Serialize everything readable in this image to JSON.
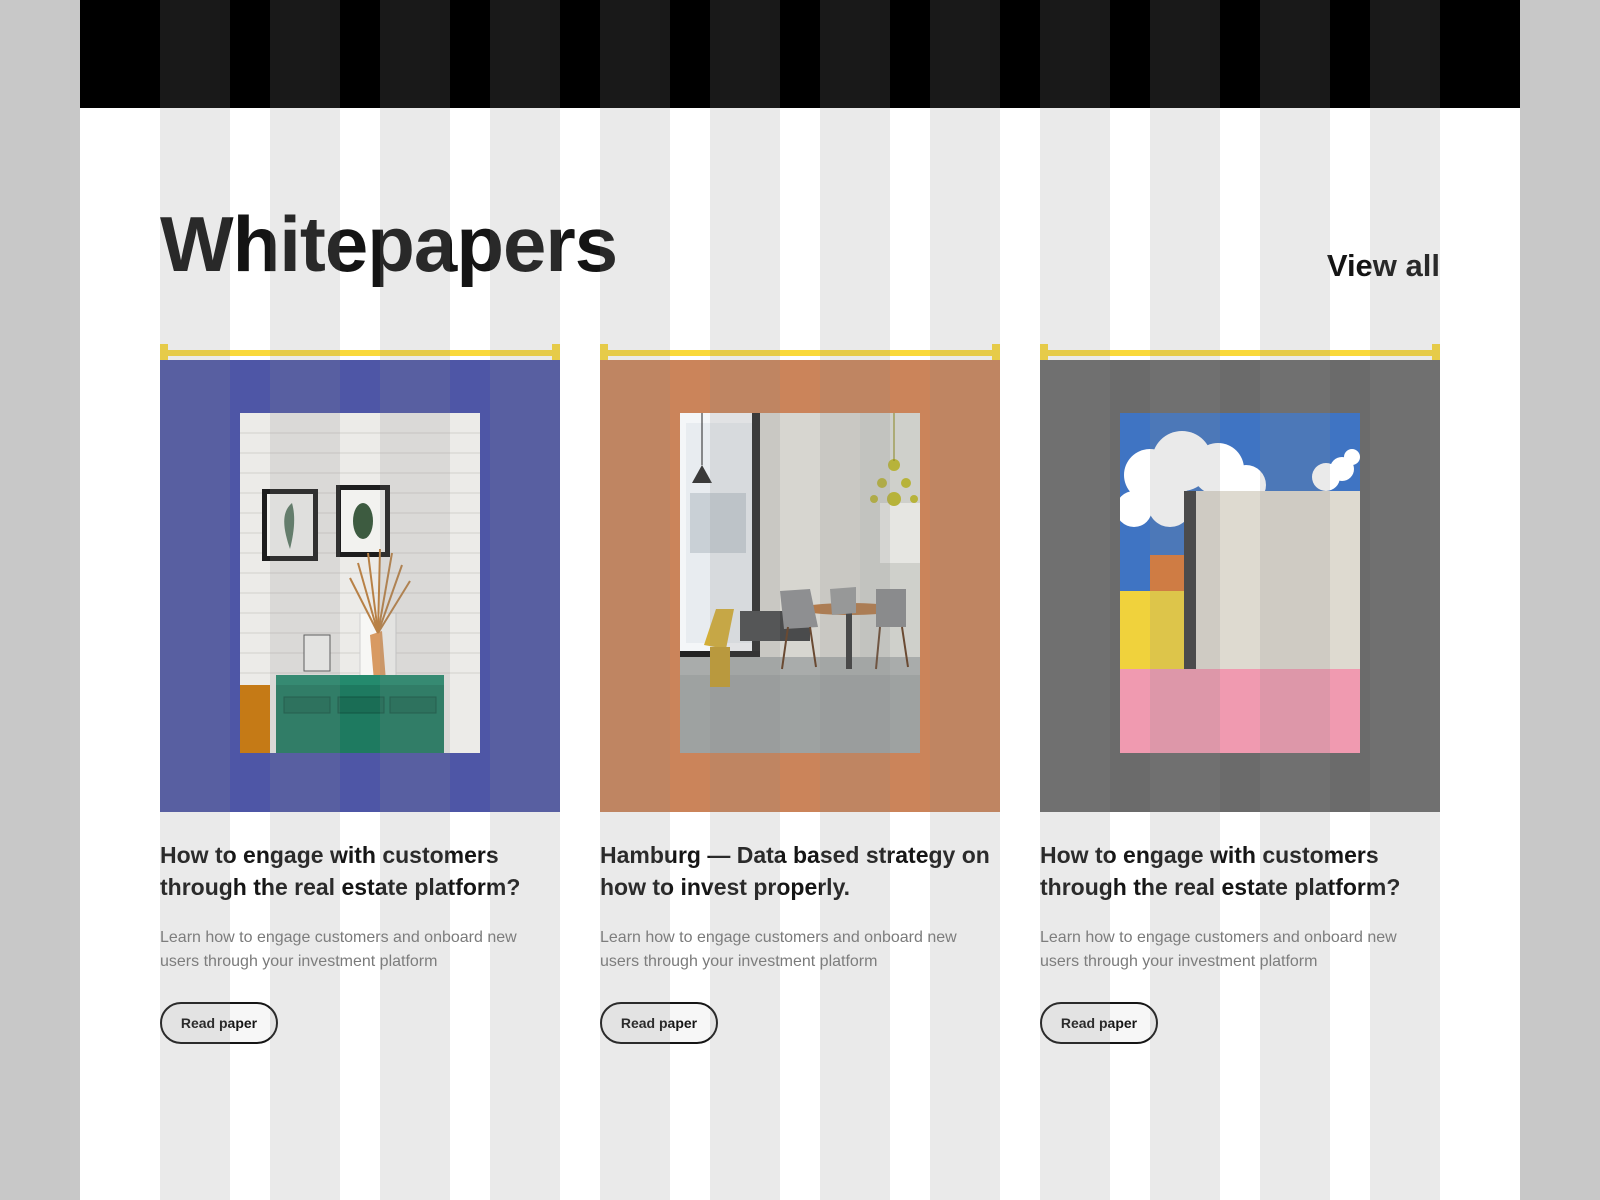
{
  "section": {
    "title": "Whitepapers",
    "view_all_label": "View all"
  },
  "cards": [
    {
      "title": "How to engage with customers through the real estate platform?",
      "description": "Learn how to engage customers and onboard new users through your investment platform",
      "button_label": "Read paper",
      "background": "#4e56a6",
      "image": "interior-green-dresser-dried-flowers"
    },
    {
      "title": "Hamburg — Data based strategy on how to invest properly.",
      "description": "Learn how to engage customers and onboard new users through your investment platform",
      "button_label": "Read paper",
      "background": "#cb845a",
      "image": "dining-room-chairs-chandelier"
    },
    {
      "title": "How to engage with customers through the real estate platform?",
      "description": "Learn how to engage customers and onboard new users through your investment platform",
      "button_label": "Read paper",
      "background": "#6b6b6b",
      "image": "colorful-architecture-sky"
    }
  ],
  "colors": {
    "accent_selection": "#fad93b",
    "top_bar": "#000000",
    "text_primary": "#141414",
    "text_muted": "#7a7a7a"
  }
}
